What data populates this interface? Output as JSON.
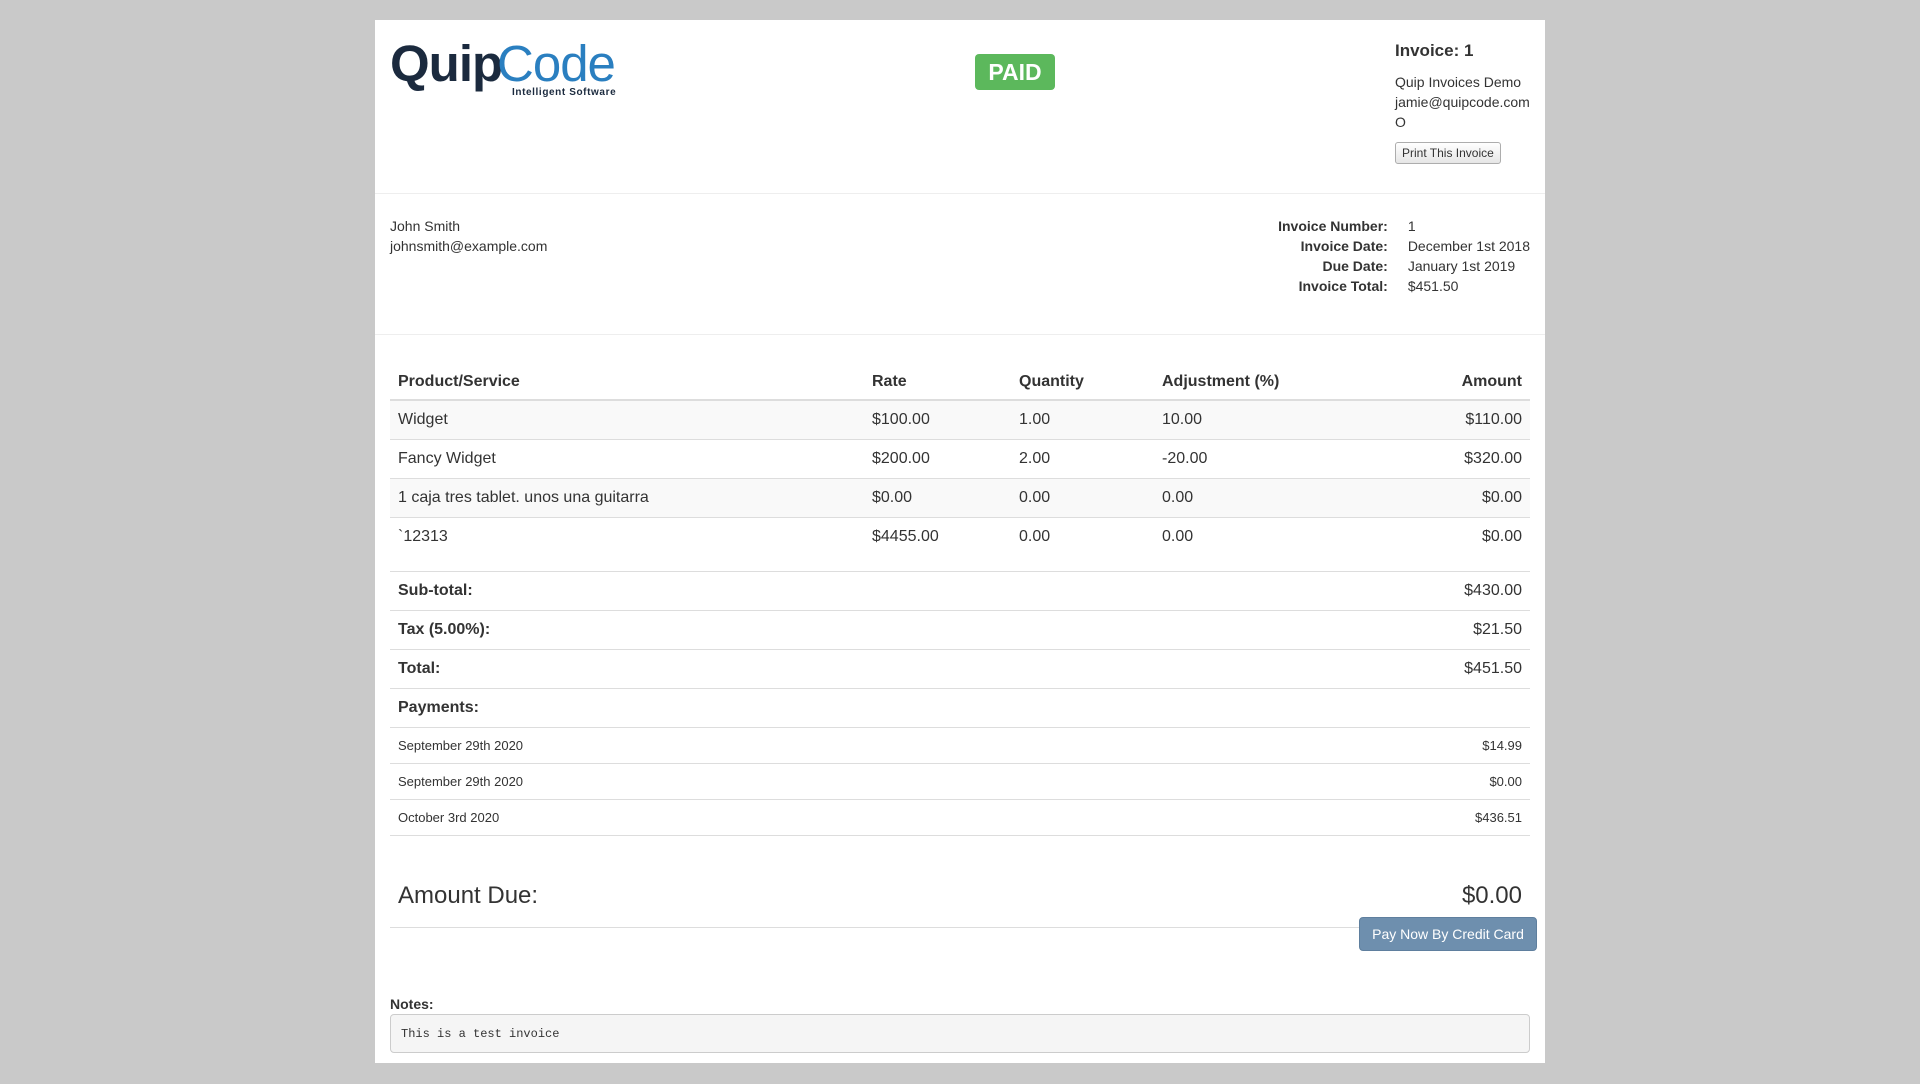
{
  "logo": {
    "quip": "Quip",
    "code": "Code",
    "tagline": "Intelligent Software"
  },
  "status_badge": "PAID",
  "seller": {
    "invoice_title": "Invoice: 1",
    "name": "Quip Invoices Demo",
    "email": "jamie@quipcode.com",
    "extra": "O",
    "print_label": "Print This Invoice"
  },
  "client": {
    "name": "John Smith",
    "email": "johnsmith@example.com"
  },
  "meta": [
    {
      "label": "Invoice Number:",
      "value": "1"
    },
    {
      "label": "Invoice Date:",
      "value": "December 1st 2018"
    },
    {
      "label": "Due Date:",
      "value": "January 1st 2019"
    },
    {
      "label": "Invoice Total:",
      "value": "$451.50"
    }
  ],
  "items": {
    "headers": [
      "Product/Service",
      "Rate",
      "Quantity",
      "Adjustment (%)",
      "Amount"
    ],
    "rows": [
      [
        "Widget",
        "$100.00",
        "1.00",
        "10.00",
        "$110.00"
      ],
      [
        "Fancy Widget",
        "$200.00",
        "2.00",
        "-20.00",
        "$320.00"
      ],
      [
        "1 caja tres tablet. unos una guitarra",
        "$0.00",
        "0.00",
        "0.00",
        "$0.00"
      ],
      [
        "`12313",
        "$4455.00",
        "0.00",
        "0.00",
        "$0.00"
      ]
    ]
  },
  "totals": {
    "subtotal_label": "Sub-total:",
    "subtotal": "$430.00",
    "tax_label": "Tax (5.00%):",
    "tax": "$21.50",
    "total_label": "Total:",
    "total": "$451.50",
    "payments_label": "Payments:",
    "payments": [
      {
        "date": "September 29th 2020",
        "amount": "$14.99"
      },
      {
        "date": "September 29th 2020",
        "amount": "$0.00"
      },
      {
        "date": "October 3rd 2020",
        "amount": "$436.51"
      }
    ]
  },
  "amount_due": {
    "label": "Amount Due:",
    "value": "$0.00"
  },
  "pay_button": "Pay Now By Credit Card",
  "notes": {
    "label": "Notes:",
    "text": "This is a test invoice"
  },
  "colors": {
    "paid_badge": "#5cb85c",
    "pay_button": "#6e8fae",
    "logo_dark": "#1b2a3e",
    "logo_blue": "#2a7fc0"
  }
}
